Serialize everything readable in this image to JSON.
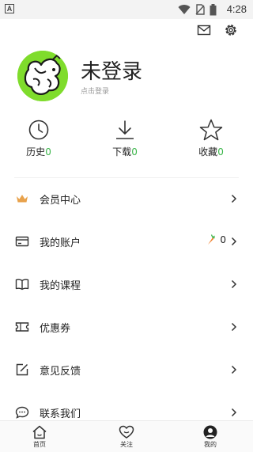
{
  "status_bar": {
    "time": "4:28",
    "app_icon_letter": "A",
    "icons": [
      "wifi-icon",
      "no-sim-icon",
      "battery-icon"
    ]
  },
  "header": {
    "icons": [
      "mail-icon",
      "settings-gear-icon"
    ]
  },
  "profile": {
    "title": "未登录",
    "subtitle": "点击登录",
    "avatar_bg": "#7fdc2c"
  },
  "stats": [
    {
      "label": "历史",
      "count": "0",
      "icon": "clock-icon"
    },
    {
      "label": "下载",
      "count": "0",
      "icon": "download-icon"
    },
    {
      "label": "收藏",
      "count": "0",
      "icon": "star-icon"
    }
  ],
  "menu": [
    {
      "label": "会员中心",
      "icon": "crown-icon"
    },
    {
      "label": "我的账户",
      "icon": "wallet-card-icon",
      "extra": "0",
      "extra_icon": "carrot-icon"
    },
    {
      "label": "我的课程",
      "icon": "book-icon"
    },
    {
      "label": "优惠券",
      "icon": "coupon-icon"
    },
    {
      "label": "意见反馈",
      "icon": "edit-icon"
    },
    {
      "label": "联系我们",
      "icon": "chat-bubble-icon"
    }
  ],
  "bottom_nav": [
    {
      "label": "首页",
      "icon": "home-icon"
    },
    {
      "label": "关注",
      "icon": "heart-icon"
    },
    {
      "label": "我的",
      "icon": "user-avatar-icon",
      "active": true
    }
  ],
  "colors": {
    "accent_green": "#3bb54a",
    "crown_orange": "#e8a24c",
    "carrot_orange": "#f07b25"
  }
}
